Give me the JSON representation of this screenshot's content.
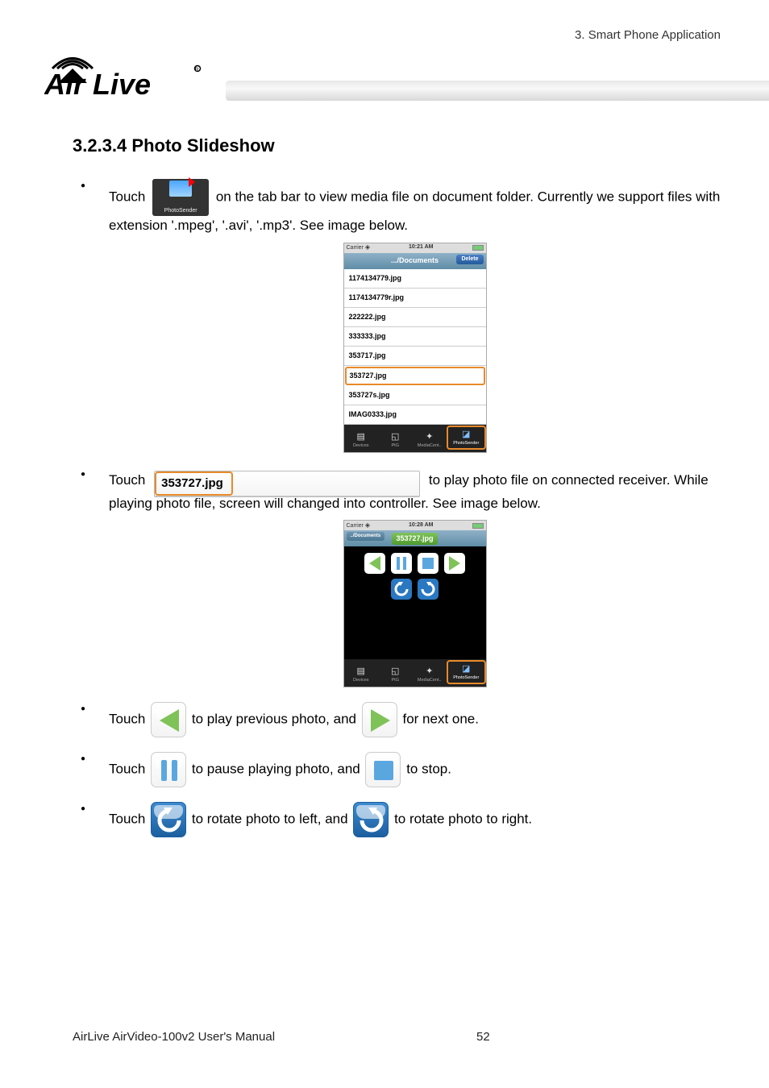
{
  "header": {
    "chapter_label": "3. Smart Phone Application",
    "logo_text": "Air Live",
    "logo_mark_alt": "airlive-logo"
  },
  "section": {
    "heading": "3.2.3.4 Photo Slideshow"
  },
  "bullet1": {
    "t1": "Touch",
    "tab_icon_label": "PhotoSender",
    "t2": "on the tab bar to view media file on document folder.    Currently we support files with extension '.mpeg', '.avi', '.mp3'.    See image below."
  },
  "screenshot_files": {
    "carrier": "Carrier",
    "time": "10:21 AM",
    "delete_btn": "Delete",
    "nav_title": ".../Documents",
    "rows": [
      "1174134779.jpg",
      "1174134779r.jpg",
      "222222.jpg",
      "333333.jpg",
      "353717.jpg",
      "353727.jpg",
      "353727s.jpg",
      "IMAG0333.jpg"
    ],
    "selected_index": 5,
    "tabs": [
      "Devices",
      "PtG",
      "MediaCent..",
      "PhotoSender"
    ],
    "active_tab_index": 3
  },
  "bullet2": {
    "t1": "Touch",
    "file_button_label": "353727.jpg",
    "t2": "to play photo file on connected receiver. While playing photo file, screen will changed into controller.    See image below."
  },
  "screenshot_controller": {
    "carrier": "Carrier",
    "time": "10:28 AM",
    "nav_left": "../Documents",
    "nav_title": "353727.jpg",
    "tabs": [
      "Devices",
      "PtG",
      "MediaCent..",
      "PhotoSender"
    ],
    "active_tab_index": 3
  },
  "bullet3": {
    "t1": "Touch",
    "t2": "to play previous photo, and",
    "t3": "for next one."
  },
  "bullet4": {
    "t1": "Touch",
    "t2": "to pause playing photo, and",
    "t3": "to stop."
  },
  "bullet5": {
    "t1": "Touch",
    "t2": "to rotate photo to left, and",
    "t3": "to rotate photo to right."
  },
  "footer": {
    "manual_title": "AirLive AirVideo-100v2 User's Manual",
    "page_number": "52"
  },
  "icons": {
    "prev": "previous-icon",
    "next": "next-icon",
    "pause": "pause-icon",
    "stop": "stop-icon",
    "rotate_left": "rotate-left-icon",
    "rotate_right": "rotate-right-icon"
  }
}
